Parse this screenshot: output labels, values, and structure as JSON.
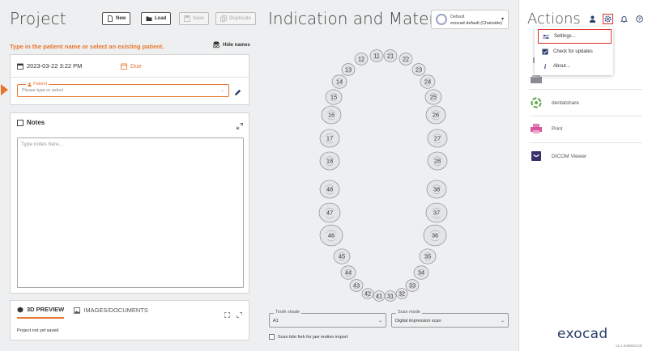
{
  "window_controls": [
    "–",
    "☐",
    "✕"
  ],
  "project": {
    "title": "Project",
    "buttons": {
      "new": "New",
      "load": "Load",
      "save": "Save",
      "duplicate": "Duplicate"
    },
    "hint": "Type in the patient name or select an existing patient.",
    "hide_names": "Hide names",
    "date": "2023-03-22 3:22 PM",
    "due": "Due",
    "patient_label": "Patient",
    "patient_placeholder": "Please type or select",
    "notes_title": "Notes",
    "notes_placeholder": "Type notes here...",
    "preview_tabs": [
      "3D PREVIEW",
      "IMAGES/DOCUMENTS"
    ],
    "preview_status": "Project not yet saved"
  },
  "indication": {
    "title": "Indication and Materials",
    "profile_line1": "Default",
    "profile_line2": "exocad default (Chairside)",
    "upper_teeth": [
      "18",
      "17",
      "16",
      "15",
      "14",
      "13",
      "12",
      "11",
      "21",
      "22",
      "23",
      "24",
      "25",
      "26",
      "27",
      "28"
    ],
    "lower_teeth": [
      "48",
      "47",
      "46",
      "45",
      "44",
      "43",
      "42",
      "41",
      "31",
      "32",
      "33",
      "34",
      "35",
      "36",
      "37",
      "38"
    ],
    "tooth_shade_label": "Tooth shade",
    "tooth_shade_value": "A1",
    "scan_mode_label": "Scan mode",
    "scan_mode_value": "Digital impression scan",
    "bite_fork_label": "Scan bite fork for jaw motion import"
  },
  "actions": {
    "title": "Actions",
    "items": [
      {
        "label": "",
        "icon": "hand-icon"
      },
      {
        "label": "",
        "icon": "scanner-icon"
      },
      {
        "label": "dentalshare",
        "icon": "dentalshare-icon"
      },
      {
        "label": "Print",
        "icon": "printer-icon"
      },
      {
        "label": "DICOM Viewer",
        "icon": "dicom-icon"
      }
    ],
    "menu": [
      "Settings...",
      "Check for updates",
      "About..."
    ],
    "brand": "exocad",
    "version": "v3.1-8480/6AC5"
  },
  "colors": {
    "accent": "#e8752d",
    "highlight": "#e03030",
    "brand": "#2b3d6b"
  }
}
